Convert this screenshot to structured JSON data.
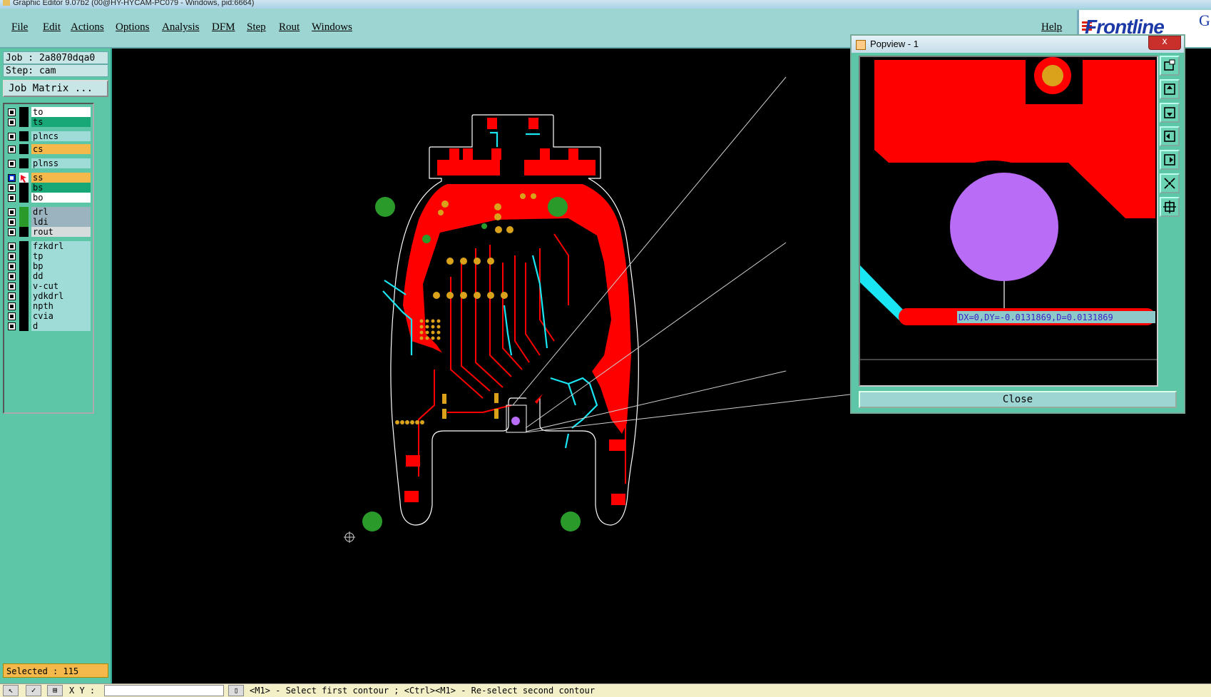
{
  "window": {
    "title": "Graphic Editor 9.07b2 (00@HY-HYCAM-PC079 - Windows, pid:6664)"
  },
  "menu": {
    "items": [
      "File",
      "Edit",
      "Actions",
      "Options",
      "Analysis",
      "DFM",
      "Step",
      "Rout",
      "Windows"
    ],
    "help": "Help"
  },
  "logo": {
    "text": "Frontline",
    "suffix": "G"
  },
  "info": {
    "job": "Job : 2a8070dqa0",
    "step": "Step: cam",
    "job_matrix": "Job Matrix ..."
  },
  "layers": [
    {
      "name": "to",
      "color": "#ffffff"
    },
    {
      "name": "ts",
      "color": "#18a878"
    },
    {
      "name": "plncs",
      "color": "#9fdcd8"
    },
    {
      "name": "cs",
      "color": "#f4b94a"
    },
    {
      "name": "plnss",
      "color": "#9fdcd8"
    },
    {
      "name": "ss",
      "color": "#f4b94a",
      "active": true
    },
    {
      "name": "bs",
      "color": "#18a878"
    },
    {
      "name": "bo",
      "color": "#ffffff"
    },
    {
      "name": "drl",
      "color": "#9ab3bf"
    },
    {
      "name": "ldi",
      "color": "#9ab3bf"
    },
    {
      "name": "rout",
      "color": "#d6dcdc"
    },
    {
      "name": "fzkdrl",
      "color": "#9fdcd8"
    },
    {
      "name": "tp",
      "color": "#9fdcd8"
    },
    {
      "name": "bp",
      "color": "#9fdcd8"
    },
    {
      "name": "dd",
      "color": "#9fdcd8"
    },
    {
      "name": "v-cut",
      "color": "#9fdcd8"
    },
    {
      "name": "ydkdrl",
      "color": "#9fdcd8"
    },
    {
      "name": "npth",
      "color": "#9fdcd8"
    },
    {
      "name": "cvia",
      "color": "#9fdcd8"
    },
    {
      "name": "d",
      "color": "#9fdcd8"
    }
  ],
  "selected": "Selected : 115",
  "status": {
    "xy_label": "X Y :",
    "message": "<M1> - Select first contour ; <Ctrl><M1> - Re-select second contour"
  },
  "popview": {
    "title": "Popview - 1",
    "close_x": "x",
    "measurement": "DX=0,DY=-0.0131869,D=0.0131869",
    "close_label": "Close"
  },
  "colors": {
    "copper": "#ff0000",
    "trace_cyan": "#19e6f2",
    "hole_green": "#2a9a2a",
    "pad_gold": "#d9a21a",
    "pad_purple": "#b96cf5",
    "panel": "#5cc6a6"
  }
}
